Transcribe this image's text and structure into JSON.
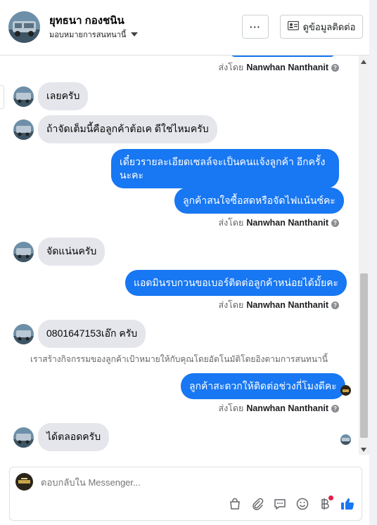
{
  "header": {
    "name": "ยุทธนา กองชนิน",
    "subtitle": "มอบหมายการสนทนานี้",
    "more_label": "···",
    "info_label": "ดูข้อมูลติดต่อ"
  },
  "sent_by": {
    "prefix": "ส่งโดย",
    "name": "Nanwhan Nanthanit"
  },
  "messages": [
    {
      "direction": "in",
      "text": "เลยครับ"
    },
    {
      "direction": "in",
      "text": "ถ้าจัดเต็มนี้คือลูกค้าต้อเค ดีใช่ไหมครับ"
    },
    {
      "direction": "out",
      "text": "เดี๋ยวรายละเอียดเซลล์จะเป็นคนแจ้งลูกค้า อีกครั้งนะคะ"
    },
    {
      "direction": "out",
      "text": "ลูกค้าสนใจซื้อสดหรือจัดไฟแน้นซ์คะ"
    },
    {
      "direction": "in",
      "text": "จัดแน่นครับ"
    },
    {
      "direction": "out",
      "text": "แอดมินรบกวนขอเบอร์ติดต่อลูกค้าหน่อยได้มั้ยคะ"
    },
    {
      "direction": "in",
      "text": "0801647153เอ๊ก ครับ"
    },
    {
      "direction": "system",
      "text": "เราสร้างกิจกรรมของลูกค้าเป้าหมายให้กับคุณโดยอัตโนมัติโดยอิงตามการสนทนานี้"
    },
    {
      "direction": "out",
      "text": "ลูกค้าสะดวกให้ติดต่อช่วงกี่โมงดีคะ"
    },
    {
      "direction": "in",
      "text": "ได้ตลอดครับ"
    }
  ],
  "composer": {
    "placeholder": "ตอบกลับใน Messenger..."
  },
  "colors": {
    "outgoing_bubble": "#1877f2",
    "incoming_bubble": "#e4e6eb",
    "like_icon": "#1877f2"
  },
  "icons": [
    "more-icon",
    "contact-card-icon",
    "bag-icon",
    "paperclip-icon",
    "chat-bubble-icon",
    "emoji-icon",
    "baht-icon",
    "thumbs-up-icon",
    "question-icon"
  ]
}
